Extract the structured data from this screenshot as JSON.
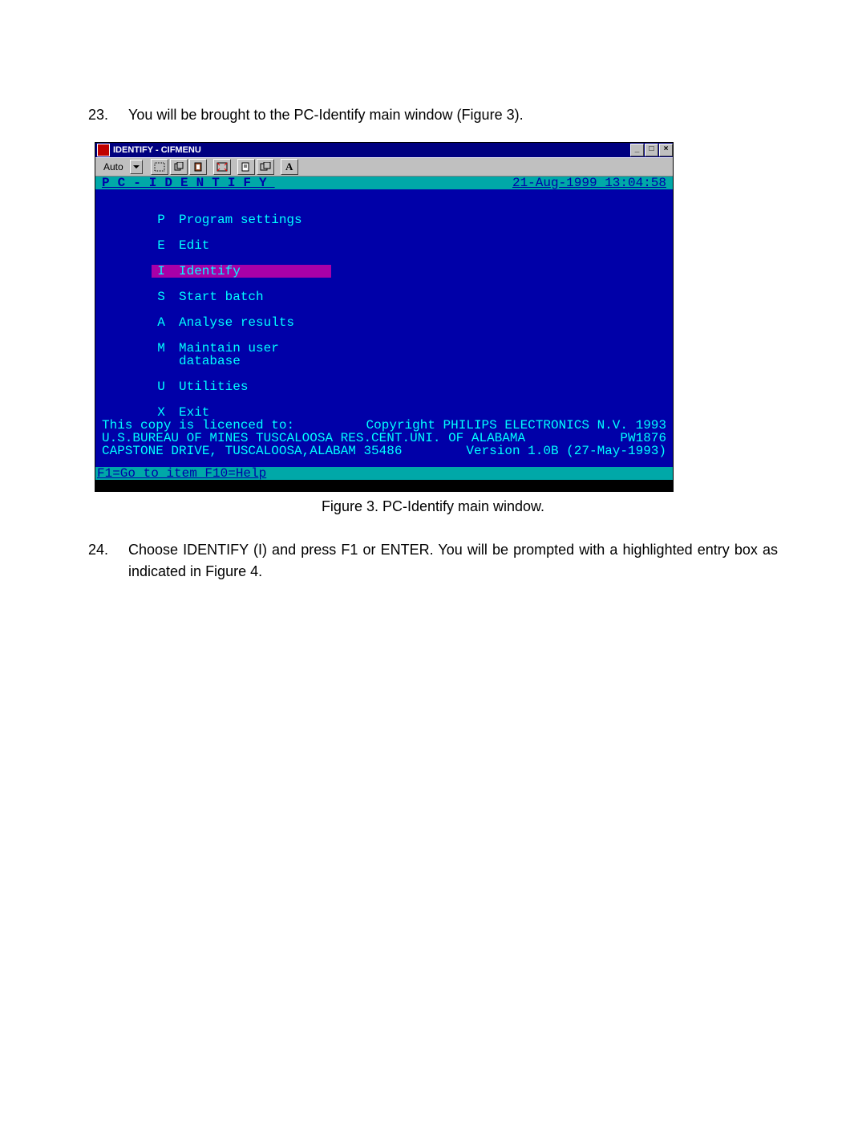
{
  "step23": {
    "num": "23.",
    "text": "You will be brought to the PC-Identify main window (Figure 3)."
  },
  "step24": {
    "num": "24.",
    "text": "Choose IDENTIFY (I) and press F1 or ENTER.  You will be prompted with a highlighted entry box as indicated in Figure 4."
  },
  "caption": "Figure 3.  PC-Identify main window.",
  "window": {
    "title": "IDENTIFY - CIFMENU",
    "toolbar_auto": "Auto"
  },
  "terminal": {
    "title": "PC-IDENTIFY",
    "datetime": "21-Aug-1999 13:04:58",
    "menu": [
      {
        "key": "P",
        "label": "Program settings",
        "highlight": false
      },
      {
        "key": "E",
        "label": "Edit",
        "highlight": false
      },
      {
        "key": "I",
        "label": "Identify",
        "highlight": true
      },
      {
        "key": "S",
        "label": "Start batch",
        "highlight": false
      },
      {
        "key": "A",
        "label": "Analyse results",
        "highlight": false
      },
      {
        "key": "M",
        "label": "Maintain user database",
        "highlight": false
      },
      {
        "key": "U",
        "label": "Utilities",
        "highlight": false
      },
      {
        "key": "X",
        "label": "Exit",
        "highlight": false
      }
    ],
    "footer": {
      "line1_left": "This copy is licenced to:",
      "line1_right": "Copyright PHILIPS ELECTRONICS N.V. 1993",
      "line2_left": "U.S.BUREAU OF MINES TUSCALOOSA RES.CENT.UNI. OF ALABAMA",
      "line2_right": "PW1876",
      "line3_left": "CAPSTONE DRIVE, TUSCALOOSA,ALABAM 35486",
      "line3_right": "Version 1.0B (27-May-1993)"
    },
    "status": "F1=Go to item F10=Help"
  }
}
